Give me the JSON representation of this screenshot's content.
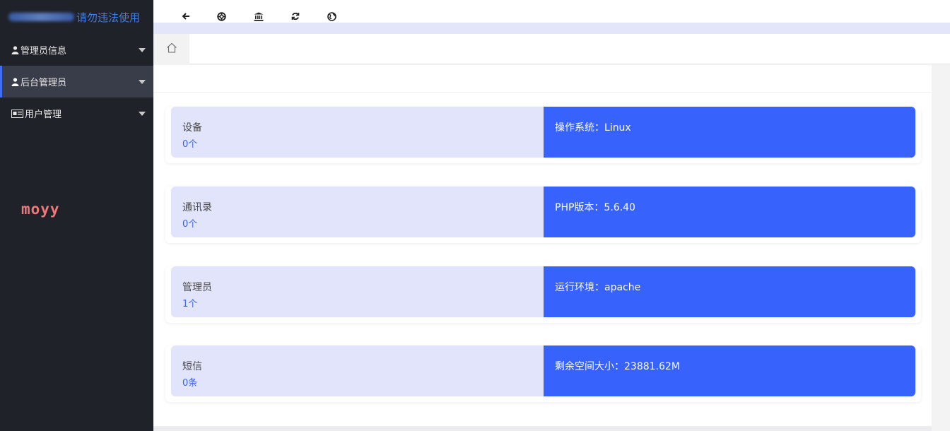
{
  "sidebar": {
    "brand_text": "请勿违法使用",
    "items": [
      {
        "label": "管理员信息",
        "icon": "user-icon"
      },
      {
        "label": "后台管理员",
        "icon": "user-icon",
        "active": true
      },
      {
        "label": "用户管理",
        "icon": "id-card-icon"
      }
    ],
    "watermark": "moyy"
  },
  "toolbar": {
    "icons": [
      "back-arrow-icon",
      "life-ring-icon",
      "bank-icon",
      "refresh-icon",
      "globe-icon"
    ]
  },
  "tabs": {
    "home_icon": "home-icon"
  },
  "cards": [
    {
      "title": "设备",
      "count": "0个",
      "info": "操作系统：Linux"
    },
    {
      "title": "通讯录",
      "count": "0个",
      "info": "PHP版本：5.6.40"
    },
    {
      "title": "管理员",
      "count": "1个",
      "info": "运行环境：apache"
    },
    {
      "title": "短信",
      "count": "0条",
      "info": "剩余空间大小：23881.62M"
    }
  ],
  "colors": {
    "sidebar_bg": "#20222a",
    "accent": "#3762fb",
    "card_light": "#e1e4fb",
    "brand": "#3e7fe6",
    "watermark": "#f0787a"
  }
}
